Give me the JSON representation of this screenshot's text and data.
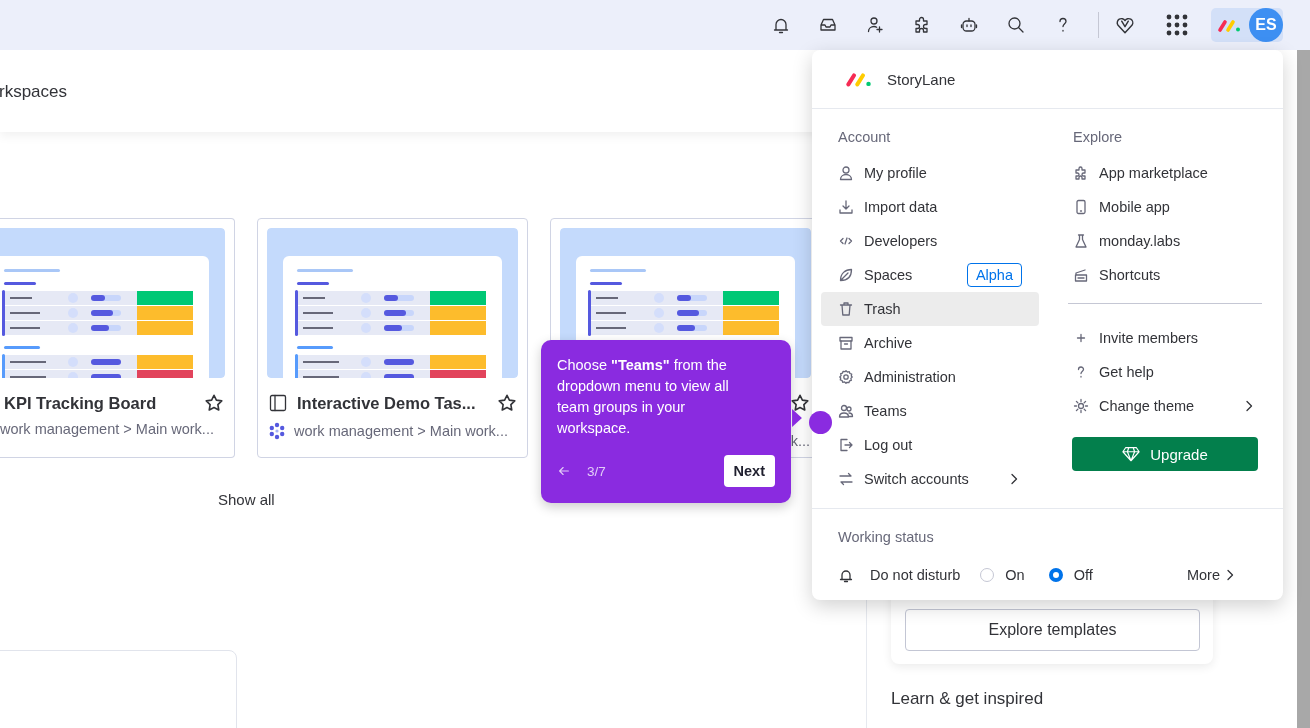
{
  "top_bar": {
    "avatar_initials": "ES"
  },
  "workspace_header": {
    "title": "rkspaces"
  },
  "boards": [
    {
      "kind": "cut",
      "title": "KPI Tracking Board",
      "path": "work management > Main work...",
      "starred": false
    },
    {
      "kind": "full",
      "title": "Interactive Demo Tas...",
      "path": "work management > Main work...",
      "starred": false
    },
    {
      "kind": "covered",
      "path": "k...",
      "starred": false
    }
  ],
  "show_all": "Show all",
  "tour_tooltip": {
    "text": "Choose **\"Teams\"** from the dropdown menu to view all team groups in your workspace.",
    "step": "3/7",
    "next_button": "Next"
  },
  "menu": {
    "account_name": "StoryLane",
    "account_heading": "Account",
    "account_items": [
      {
        "label": "My profile",
        "selected": false,
        "submenu": false
      },
      {
        "label": "Import data",
        "selected": false,
        "submenu": false
      },
      {
        "label": "Developers",
        "selected": false,
        "submenu": false
      },
      {
        "label": "Spaces",
        "selected": false,
        "submenu": false,
        "badge": "Alpha"
      },
      {
        "label": "Trash",
        "selected": true,
        "submenu": false
      },
      {
        "label": "Archive",
        "selected": false,
        "submenu": false
      },
      {
        "label": "Administration",
        "selected": false,
        "submenu": false
      },
      {
        "label": "Teams",
        "selected": false,
        "submenu": false
      },
      {
        "label": "Log out",
        "selected": false,
        "submenu": false
      },
      {
        "label": "Switch accounts",
        "selected": false,
        "submenu": true
      }
    ],
    "explore_heading": "Explore",
    "explore_items": [
      {
        "label": "App marketplace",
        "selected": false,
        "submenu": false
      },
      {
        "label": "Mobile app",
        "selected": false,
        "submenu": false
      },
      {
        "label": "monday.labs",
        "selected": false,
        "submenu": false
      },
      {
        "label": "Shortcuts",
        "selected": false,
        "submenu": false
      }
    ],
    "more_items": [
      {
        "label": "Invite members",
        "selected": false,
        "submenu": false
      },
      {
        "label": "Get help",
        "selected": false,
        "submenu": false
      },
      {
        "label": "Change theme",
        "selected": false,
        "submenu": true
      }
    ],
    "upgrade_button": "Upgrade",
    "working_status": {
      "heading": "Working status",
      "label": "Do not disturb",
      "options": [
        {
          "label": "On",
          "selected": false
        },
        {
          "label": "Off",
          "selected": true
        }
      ],
      "more": "More"
    }
  },
  "side_panel": {
    "explore_templates_button": "Explore templates",
    "learn_heading": "Learn & get inspired"
  }
}
